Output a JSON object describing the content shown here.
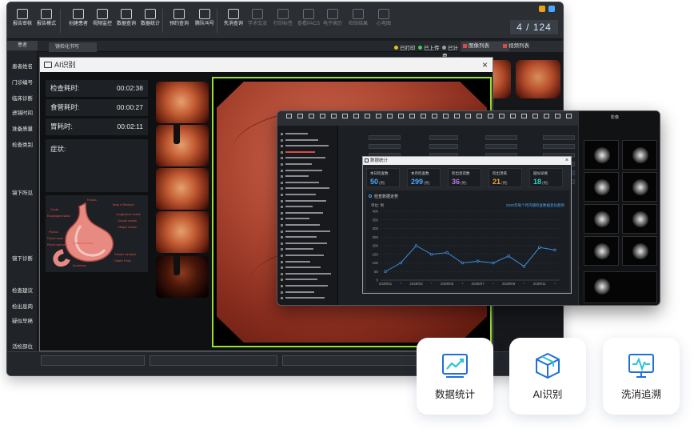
{
  "main_window": {
    "toolbar_buttons": [
      {
        "label": "报告审核",
        "dim": false
      },
      {
        "label": "报告模式",
        "dim": false
      },
      {
        "label": "创建患者",
        "dim": false
      },
      {
        "label": "视频监控",
        "dim": false
      },
      {
        "label": "数据查询",
        "dim": false
      },
      {
        "label": "数据统计",
        "dim": false
      },
      {
        "label": "预约查询",
        "dim": false
      },
      {
        "label": "腾队叫号",
        "dim": false
      },
      {
        "label": "失消查询",
        "dim": false
      },
      {
        "label": "学术交流",
        "dim": true
      },
      {
        "label": "打印标签",
        "dim": true
      },
      {
        "label": "查看PACS",
        "dim": true
      },
      {
        "label": "电子病历",
        "dim": true
      },
      {
        "label": "检验结果",
        "dim": true
      },
      {
        "label": "心电图",
        "dim": true
      }
    ],
    "page_indicator": "4 / 124",
    "top_dot_colors": [
      "#e8a317",
      "#4aa8ff"
    ],
    "left_header": "患者",
    "left_items": [
      "患者姓名",
      "门诊编号",
      "临床诊断",
      "进镜时间",
      "准备质量",
      "检查类别",
      "镜下所见",
      "镜下诊断",
      "检查建议",
      "检出息肉",
      "疑似早癌",
      "活检部位"
    ],
    "report_tab": "镜检化书写",
    "status_chips": [
      {
        "label": "已打印",
        "color": "#e8c517"
      },
      {
        "label": "已上传",
        "color": "#3fcf4e"
      },
      {
        "label": "已计费",
        "color": "#9aa0a6"
      }
    ],
    "right_tabs": [
      "图像列表",
      "视频列表"
    ]
  },
  "ai_dialog": {
    "title": "AI识别",
    "close": "×",
    "info_rows": [
      {
        "label": "检查耗时:",
        "value": "00:02:38"
      },
      {
        "label": "食管耗时:",
        "value": "00:00:27"
      },
      {
        "label": "胃耗时:",
        "value": "00:02:11"
      }
    ],
    "symptom_label": "症状:",
    "anatomy_labels": [
      "Fundus",
      "Body of Stomach",
      "Cardia",
      "Esophageal hiatus",
      "Longitudinal muscle",
      "Circular muscle",
      "Oblique muscle",
      "Pylorus",
      "Pyloric canal",
      "Pyloric sphincter",
      "Lesser curvature",
      "Greater curvature",
      "Duodenum",
      "Gastric Folds"
    ]
  },
  "data_window": {
    "stats_dialog": {
      "title": "数据统计",
      "close": "×",
      "cards": [
        {
          "label": "本日检查数",
          "value": "50",
          "unit": "(例)",
          "color": "#4aa8ff"
        },
        {
          "label": "本月检查数",
          "value": "299",
          "unit": "(例)",
          "color": "#4aa8ff"
        },
        {
          "label": "检出息肉数",
          "value": "36",
          "unit": "(例)",
          "color": "#b27ae8"
        },
        {
          "label": "检出溃疡",
          "value": "21",
          "unit": "(例)",
          "color": "#f0a13a"
        },
        {
          "label": "疑似早癌",
          "value": "18",
          "unit": "(例)",
          "color": "#2ad6c4"
        }
      ],
      "chart_title": "检查数据走势",
      "chart_unit": "单位: 例",
      "chart_legend": "2020年每个月内镜检查数据变化趋势"
    },
    "scan_label": "影像"
  },
  "feature_cards": [
    {
      "label": "数据统计",
      "icon": "chart-icon"
    },
    {
      "label": "AI识别",
      "icon": "cube-icon"
    },
    {
      "label": "洗消追溯",
      "icon": "monitor-pulse-icon"
    }
  ],
  "chart_data": {
    "type": "line",
    "title": "检查数据走势",
    "ylabel": "单位: 例",
    "xlabel": "",
    "x": [
      "2020/01",
      "2020/02",
      "2020/03",
      "2020/04",
      "2020/05",
      "2020/06",
      "2020/07",
      "2020/08",
      "2020/09",
      "2020/10",
      "2020/11",
      "2020/12"
    ],
    "x_tick_labels": [
      "2020/01",
      "2020/03",
      "2020/05",
      "2020/07",
      "2020/09",
      "2020/11"
    ],
    "y_tick_labels": [
      "0",
      "50",
      "100",
      "150",
      "200",
      "250",
      "300",
      "350",
      "400"
    ],
    "series": [
      {
        "name": "2020年每个月内镜检查数据变化趋势",
        "values": [
          50,
          100,
          200,
          150,
          160,
          100,
          110,
          100,
          140,
          80,
          190,
          175
        ]
      }
    ],
    "ylim": [
      0,
      400
    ],
    "grid": true,
    "legend": "top-right",
    "color": "#3a8fe0"
  }
}
